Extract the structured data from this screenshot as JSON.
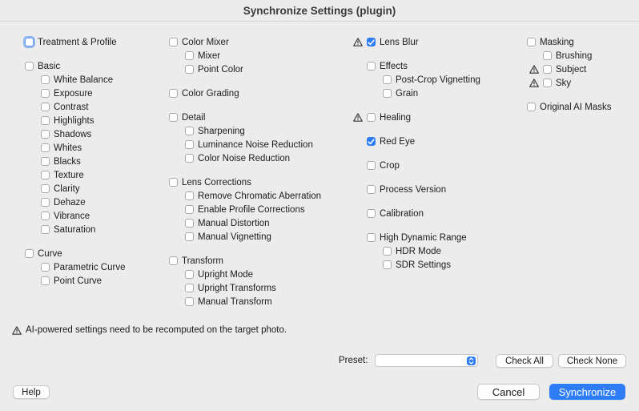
{
  "window": {
    "title": "Synchronize Settings (plugin)"
  },
  "columns": [
    [
      {
        "label": "Treatment & Profile",
        "checked": false,
        "focused": true
      },
      {
        "gap": true
      },
      {
        "label": "Basic",
        "checked": false
      },
      {
        "label": "White Balance",
        "checked": false,
        "indent": true
      },
      {
        "label": "Exposure",
        "checked": false,
        "indent": true
      },
      {
        "label": "Contrast",
        "checked": false,
        "indent": true
      },
      {
        "label": "Highlights",
        "checked": false,
        "indent": true
      },
      {
        "label": "Shadows",
        "checked": false,
        "indent": true
      },
      {
        "label": "Whites",
        "checked": false,
        "indent": true
      },
      {
        "label": "Blacks",
        "checked": false,
        "indent": true
      },
      {
        "label": "Texture",
        "checked": false,
        "indent": true
      },
      {
        "label": "Clarity",
        "checked": false,
        "indent": true
      },
      {
        "label": "Dehaze",
        "checked": false,
        "indent": true
      },
      {
        "label": "Vibrance",
        "checked": false,
        "indent": true
      },
      {
        "label": "Saturation",
        "checked": false,
        "indent": true
      },
      {
        "gap": true
      },
      {
        "label": "Curve",
        "checked": false
      },
      {
        "label": "Parametric Curve",
        "checked": false,
        "indent": true
      },
      {
        "label": "Point Curve",
        "checked": false,
        "indent": true
      }
    ],
    [
      {
        "label": "Color Mixer",
        "checked": false
      },
      {
        "label": "Mixer",
        "checked": false,
        "indent": true
      },
      {
        "label": "Point Color",
        "checked": false,
        "indent": true
      },
      {
        "gap": true
      },
      {
        "label": "Color Grading",
        "checked": false
      },
      {
        "gap": true
      },
      {
        "label": "Detail",
        "checked": false
      },
      {
        "label": "Sharpening",
        "checked": false,
        "indent": true
      },
      {
        "label": "Luminance Noise Reduction",
        "checked": false,
        "indent": true
      },
      {
        "label": "Color Noise Reduction",
        "checked": false,
        "indent": true
      },
      {
        "gap": true
      },
      {
        "label": "Lens Corrections",
        "checked": false
      },
      {
        "label": "Remove Chromatic Aberration",
        "checked": false,
        "indent": true
      },
      {
        "label": "Enable Profile Corrections",
        "checked": false,
        "indent": true
      },
      {
        "label": "Manual Distortion",
        "checked": false,
        "indent": true
      },
      {
        "label": "Manual Vignetting",
        "checked": false,
        "indent": true
      },
      {
        "gap": true
      },
      {
        "label": "Transform",
        "checked": false
      },
      {
        "label": "Upright Mode",
        "checked": false,
        "indent": true
      },
      {
        "label": "Upright Transforms",
        "checked": false,
        "indent": true
      },
      {
        "label": "Manual Transform",
        "checked": false,
        "indent": true
      }
    ],
    [
      {
        "label": "Lens Blur",
        "checked": true,
        "warning": true
      },
      {
        "gap": true
      },
      {
        "label": "Effects",
        "checked": false
      },
      {
        "label": "Post-Crop Vignetting",
        "checked": false,
        "indent": true
      },
      {
        "label": "Grain",
        "checked": false,
        "indent": true
      },
      {
        "gap": true
      },
      {
        "label": "Healing",
        "checked": false,
        "warning": true
      },
      {
        "gap": true
      },
      {
        "label": "Red Eye",
        "checked": true
      },
      {
        "gap": true
      },
      {
        "label": "Crop",
        "checked": false
      },
      {
        "gap": true
      },
      {
        "label": "Process Version",
        "checked": false
      },
      {
        "gap": true
      },
      {
        "label": "Calibration",
        "checked": false
      },
      {
        "gap": true
      },
      {
        "label": "High Dynamic Range",
        "checked": false
      },
      {
        "label": "HDR Mode",
        "checked": false,
        "indent": true
      },
      {
        "label": "SDR Settings",
        "checked": false,
        "indent": true
      }
    ],
    [
      {
        "label": "Masking",
        "checked": false
      },
      {
        "label": "Brushing",
        "checked": false,
        "indent": true
      },
      {
        "label": "Subject",
        "checked": false,
        "indent": true,
        "warning": true
      },
      {
        "label": "Sky",
        "checked": false,
        "indent": true,
        "warning": true
      },
      {
        "gap": true
      },
      {
        "label": "Original AI Masks",
        "checked": false
      }
    ]
  ],
  "notice": "AI-powered settings need to be recomputed on the target photo.",
  "preset": {
    "label": "Preset:",
    "value": ""
  },
  "buttons": {
    "check_all": "Check All",
    "check_none": "Check None",
    "help": "Help",
    "cancel": "Cancel",
    "synchronize": "Synchronize"
  },
  "colors": {
    "accent": "#2f7df6",
    "background": "#ececec"
  }
}
